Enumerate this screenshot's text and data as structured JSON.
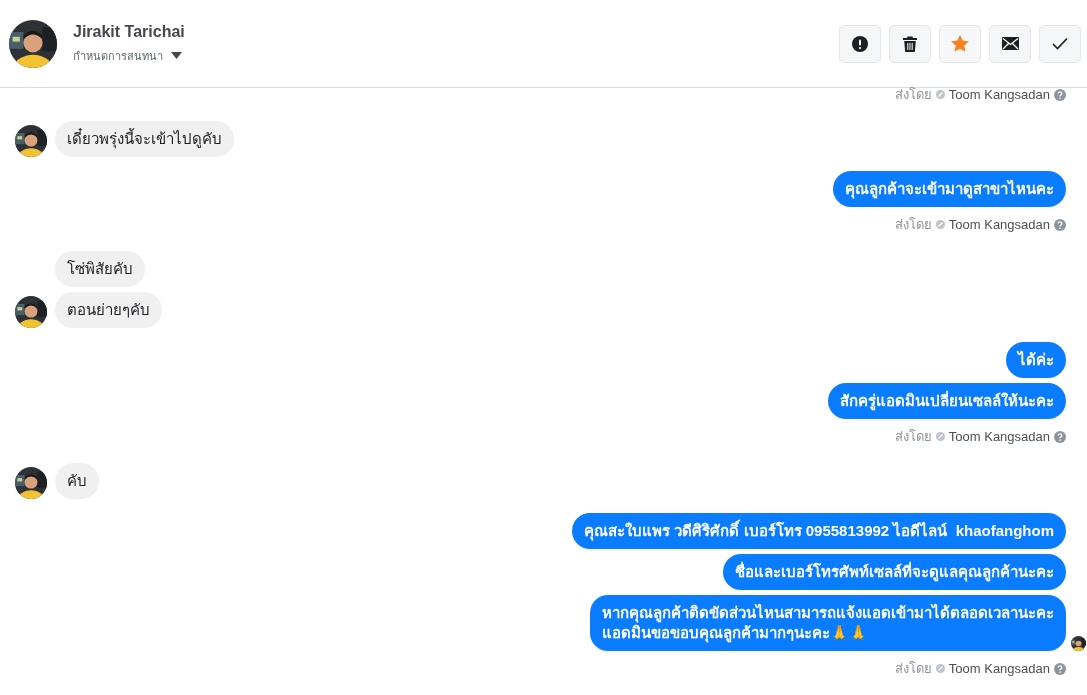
{
  "header": {
    "name": "Jirakit Tarichai",
    "subtitle": "กำหนดการสนทนา",
    "starred": true,
    "actions": [
      {
        "kind": "alert"
      },
      {
        "kind": "trash"
      },
      {
        "kind": "star"
      },
      {
        "kind": "mail"
      },
      {
        "kind": "check"
      }
    ]
  },
  "messages": [
    {
      "kind": "outgoing",
      "sender_label": "ส่งโดย",
      "sender": "Toom Kangsadan"
    },
    {
      "kind": "incoming",
      "bubbles": [
        "เดี๋ยวพรุ่งนี้จะเข้าไปดูคับ"
      ]
    },
    {
      "kind": "outgoing",
      "bubbles": [
        "คุณลูกค้าจะเข้ามาดูสาขาไหนคะ"
      ],
      "sender_label": "ส่งโดย",
      "sender": "Toom Kangsadan"
    },
    {
      "kind": "incoming",
      "bubbles": [
        "โซ่พิสัยคับ",
        "ตอนย่ายๆคับ"
      ]
    },
    {
      "kind": "outgoing",
      "bubbles": [
        "ได้ค่ะ",
        "สักครู่แอดมินเปลี่ยนเซลล์ให้นะคะ"
      ],
      "sender_label": "ส่งโดย",
      "sender": "Toom Kangsadan"
    },
    {
      "kind": "incoming",
      "bubbles": [
        "คับ"
      ]
    },
    {
      "kind": "outgoing",
      "bubbles": [
        "คุณสะใบแพร วดีศิริศักดิ์ เบอร์โทร 0955813992 ไอดีไลน์  khaofanghom",
        "ชื่อและเบอร์โทรศัพท์เซลล์ที่จะดูแลคุณลูกค้านะคะ",
        "หากคุณลูกค้าติดขัดส่วนไหนสามารถแจ้งแอดเข้ามาได้ตลอดเวลานะคะ\nแอดมินขอขอบคุณลูกค้ามากๆนะคะ🙏🙏"
      ],
      "seen": true,
      "sender_label": "ส่งโดย",
      "sender": "Toom Kangsadan"
    }
  ]
}
